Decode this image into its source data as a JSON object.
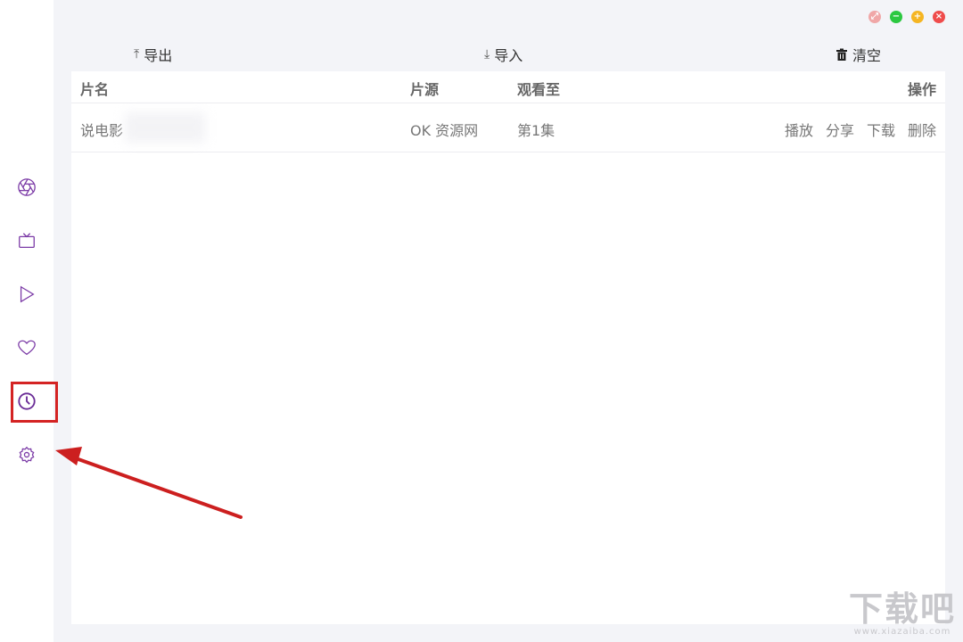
{
  "window_controls": {
    "pin_symbol": "⤢",
    "minimize_symbol": "−",
    "maximize_symbol": "+",
    "close_symbol": "×",
    "colors": {
      "pin": "#f0a7a7",
      "minimize": "#2bc840",
      "maximize": "#f5b522",
      "close": "#ef4b4b"
    }
  },
  "toolbar": {
    "export_icon": "⤒",
    "export_label": "导出",
    "import_icon": "⤓",
    "import_label": "导入",
    "clear_label": "清空"
  },
  "table": {
    "columns": {
      "name": "片名",
      "source": "片源",
      "watched_to": "观看至",
      "actions": "操作"
    },
    "rows": [
      {
        "name": "说电影",
        "source": "OK 资源网",
        "watched_to": "第1集",
        "actions": {
          "play": "播放",
          "share": "分享",
          "download": "下载",
          "delete": "删除"
        }
      }
    ]
  },
  "sidebar": {
    "items": [
      {
        "name": "aperture-icon"
      },
      {
        "name": "tv-icon"
      },
      {
        "name": "play-icon"
      },
      {
        "name": "heart-icon"
      },
      {
        "name": "history-clock-icon",
        "active": true
      },
      {
        "name": "settings-gear-icon"
      }
    ],
    "accent_color": "#7b3aa6"
  },
  "watermark": {
    "text": "下载吧",
    "url": "www.xiazaiba.com"
  },
  "colors": {
    "highlight_box": "#d42323",
    "arrow": "#cc1f1f"
  }
}
